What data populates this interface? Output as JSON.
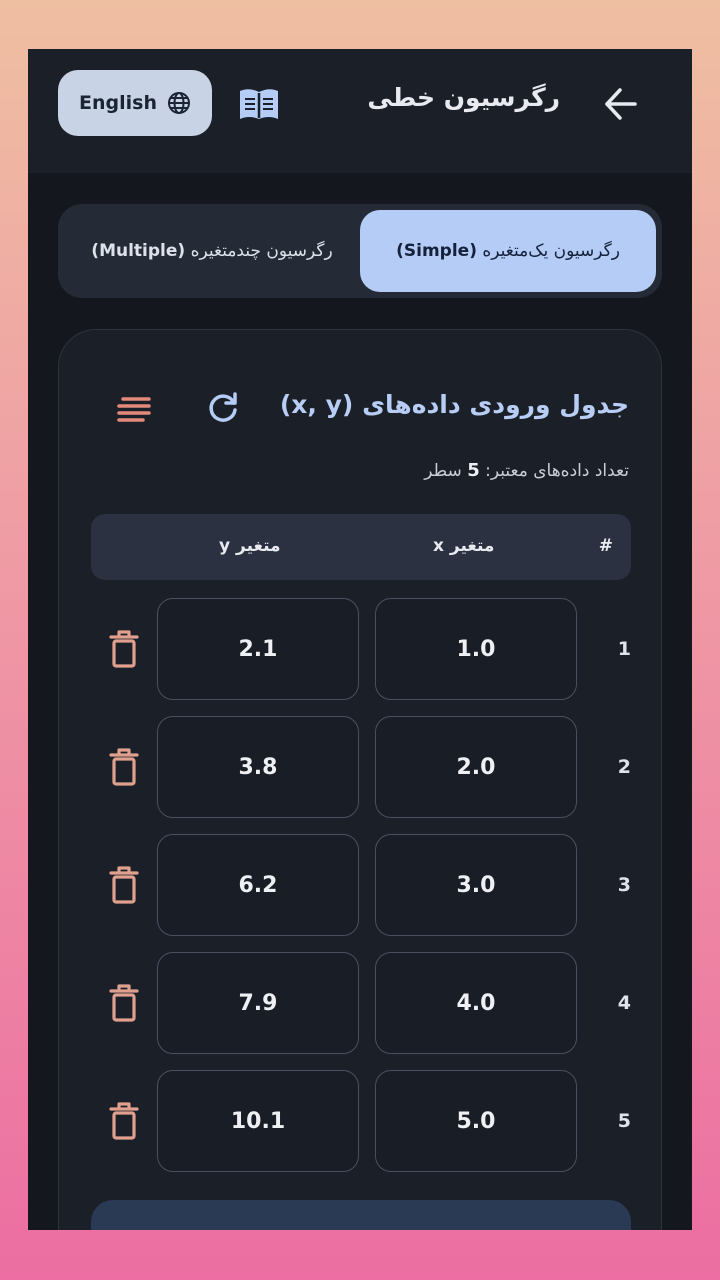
{
  "appbar": {
    "title": "رگرسیون خطی",
    "language_button": "English",
    "icons": {
      "language": "globe-icon",
      "guide": "book-icon",
      "back": "arrow-back-icon"
    }
  },
  "tabs": {
    "simple": {
      "label": "رگرسیون یک‌متغیره",
      "tag": "(Simple)"
    },
    "multiple": {
      "label": "رگرسیون چندمتغیره",
      "tag": "(Multiple)"
    },
    "selected": "simple"
  },
  "card": {
    "title_text": "جدول ورودی داده‌های",
    "title_tag": "(x, y)",
    "valid_count_label": "تعداد داده‌های معتبر:",
    "valid_count_value": "5",
    "valid_count_unit": "سطر",
    "icons": {
      "refresh": "refresh-icon",
      "sort": "sort-lines-icon",
      "delete": "trash-icon"
    }
  },
  "table": {
    "headers": {
      "num": "#",
      "x": "متغیر x",
      "y": "متغیر y"
    },
    "rows": [
      {
        "num": "1",
        "x": "1.0",
        "y": "2.1"
      },
      {
        "num": "2",
        "x": "2.0",
        "y": "3.8"
      },
      {
        "num": "3",
        "x": "3.0",
        "y": "6.2"
      },
      {
        "num": "4",
        "x": "4.0",
        "y": "7.9"
      },
      {
        "num": "5",
        "x": "5.0",
        "y": "10.1"
      }
    ]
  },
  "colors": {
    "accent": "#b5ccf6",
    "delete": "#e0a08e",
    "background": "#14171e"
  }
}
